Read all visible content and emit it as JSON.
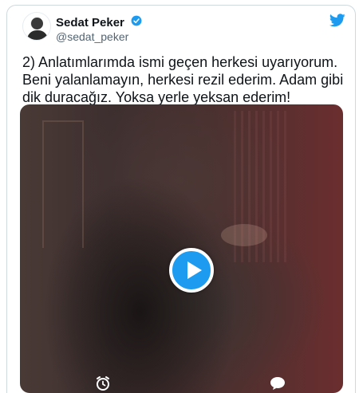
{
  "tweet": {
    "author": {
      "name": "Sedat Peker",
      "handle": "@sedat_peker",
      "verified": true,
      "avatar_icon": "user-avatar"
    },
    "text": "2) Anlatımlarımda ismi geçen herkesi uyarıyorum. Beni yalanlamayın, herkesi rezil ederim. Adam gibi dik duracağız. Yoksa yerle yeksan ederim!",
    "brand_icon": "twitter-bird-icon",
    "media": {
      "type": "video",
      "play_icon": "play-icon",
      "accent_color": "#1d9bf0",
      "overlay_icons": [
        "clock-icon",
        "speech-bubble-icon"
      ]
    }
  },
  "colors": {
    "accent": "#1d9bf0",
    "text_primary": "#0f1419",
    "text_secondary": "#536471",
    "border": "#cfd9de"
  }
}
